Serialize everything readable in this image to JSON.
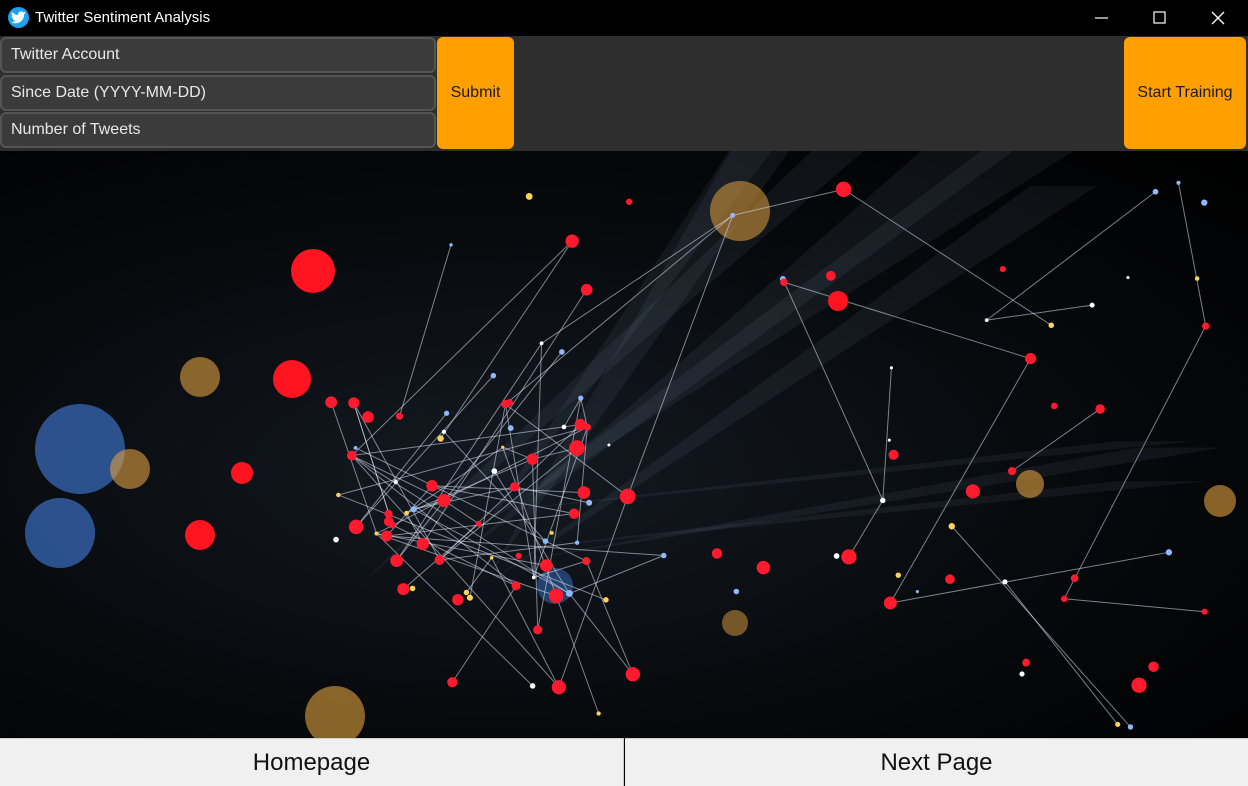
{
  "window": {
    "title": "Twitter Sentiment Analysis",
    "icon": "twitter-bird-icon",
    "controls": [
      "minimize-icon",
      "maximize-icon",
      "close-icon"
    ]
  },
  "form": {
    "account_placeholder": "Twitter Account",
    "since_date_placeholder": "Since Date  (YYYY-MM-DD)",
    "num_tweets_placeholder": "Number of Tweets",
    "submit_label": "Submit",
    "start_training_label": "Start Training"
  },
  "nav": {
    "homepage_label": "Homepage",
    "next_page_label": "Next Page"
  },
  "colors": {
    "accent": "#ffa000",
    "twitter_blue": "#1da1f2",
    "panel": "#2e2e2e",
    "field": "#3b3b3b"
  }
}
